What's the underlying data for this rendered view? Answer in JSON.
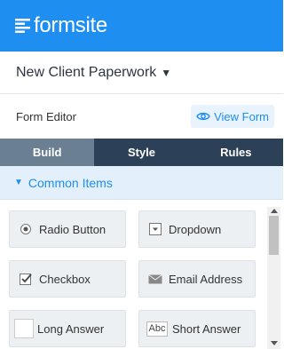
{
  "header": {
    "logo_text": "formsite",
    "brand_color": "#1e8ef0"
  },
  "form": {
    "title": "New Client Paperwork",
    "caret": "▼"
  },
  "editor": {
    "label": "Form Editor",
    "view_form_label": "View Form"
  },
  "tabs": [
    {
      "label": "Build",
      "active": true
    },
    {
      "label": "Style",
      "active": false
    },
    {
      "label": "Rules",
      "active": false
    }
  ],
  "section": {
    "title": "Common Items",
    "caret": "▼"
  },
  "items": [
    {
      "label": "Radio Button",
      "icon": "radio-icon"
    },
    {
      "label": "Dropdown",
      "icon": "dropdown-icon"
    },
    {
      "label": "Checkbox",
      "icon": "checkbox-icon"
    },
    {
      "label": "Email Address",
      "icon": "envelope-icon"
    },
    {
      "label": "Long Answer",
      "icon": "textarea-icon"
    },
    {
      "label": "Short Answer",
      "icon": "text-field-icon",
      "icon_text": "Abc"
    }
  ]
}
